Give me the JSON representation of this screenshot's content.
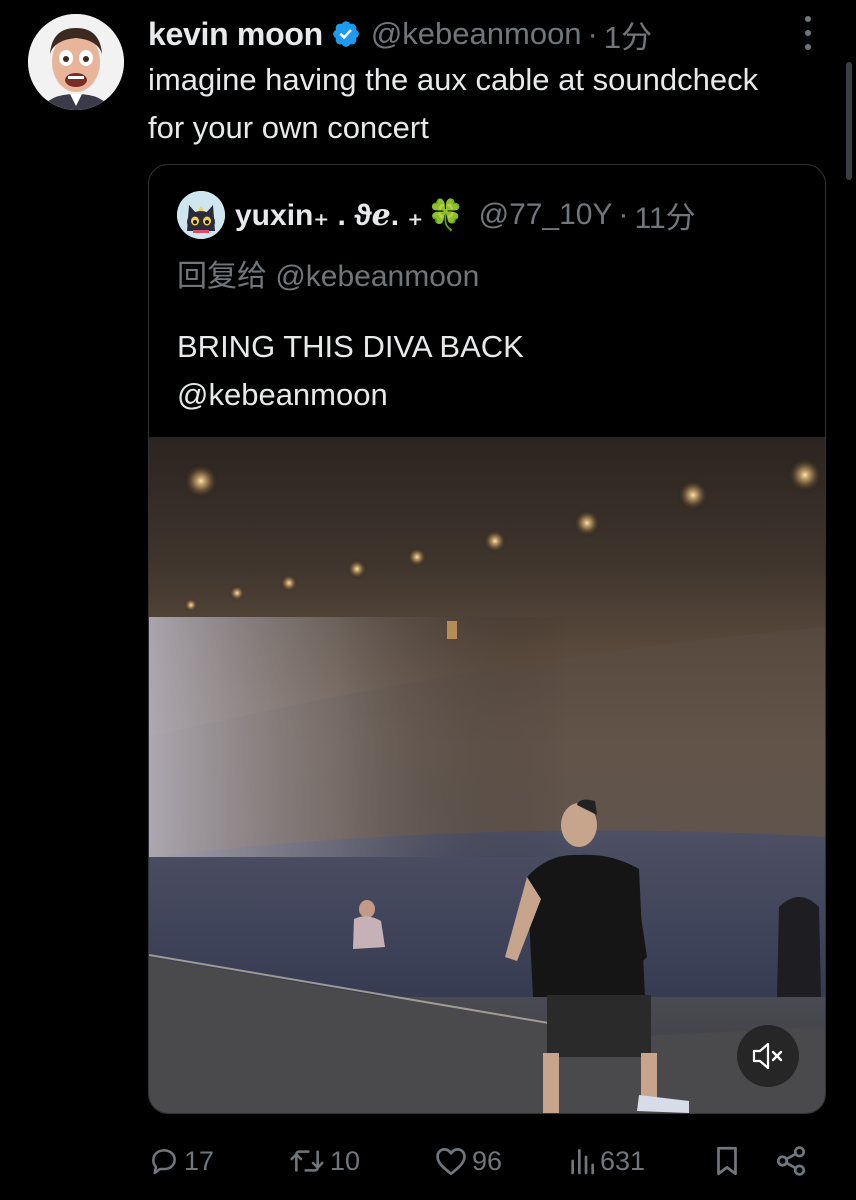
{
  "tweet": {
    "display_name": "kevin moon",
    "handle": "@kebeanmoon",
    "separator": "·",
    "time": "1分",
    "text": "imagine having the aux cable at soundcheck for your own concert"
  },
  "quote": {
    "display_name": "yuxin₊ . ϑℯ. ₊",
    "handle": "@77_10Y",
    "separator": "·",
    "time": "11分",
    "reply_to": "回复给 @kebeanmoon",
    "text_line1": "BRING THIS DIVA BACK",
    "text_line2": "@kebeanmoon"
  },
  "actions": {
    "replies": "17",
    "reposts": "10",
    "likes": "96",
    "views": "631"
  },
  "icons": {
    "verified": "verified-badge-icon",
    "more": "more-options-icon",
    "mute": "muted-speaker-icon",
    "reply": "reply-icon",
    "repost": "repost-icon",
    "like": "heart-icon",
    "views": "views-icon",
    "bookmark": "bookmark-icon",
    "share": "share-icon"
  },
  "colors": {
    "background": "#000000",
    "text": "#e7e9ea",
    "secondary": "#71767b",
    "verified": "#1d9bf0",
    "border": "#2f3336"
  }
}
